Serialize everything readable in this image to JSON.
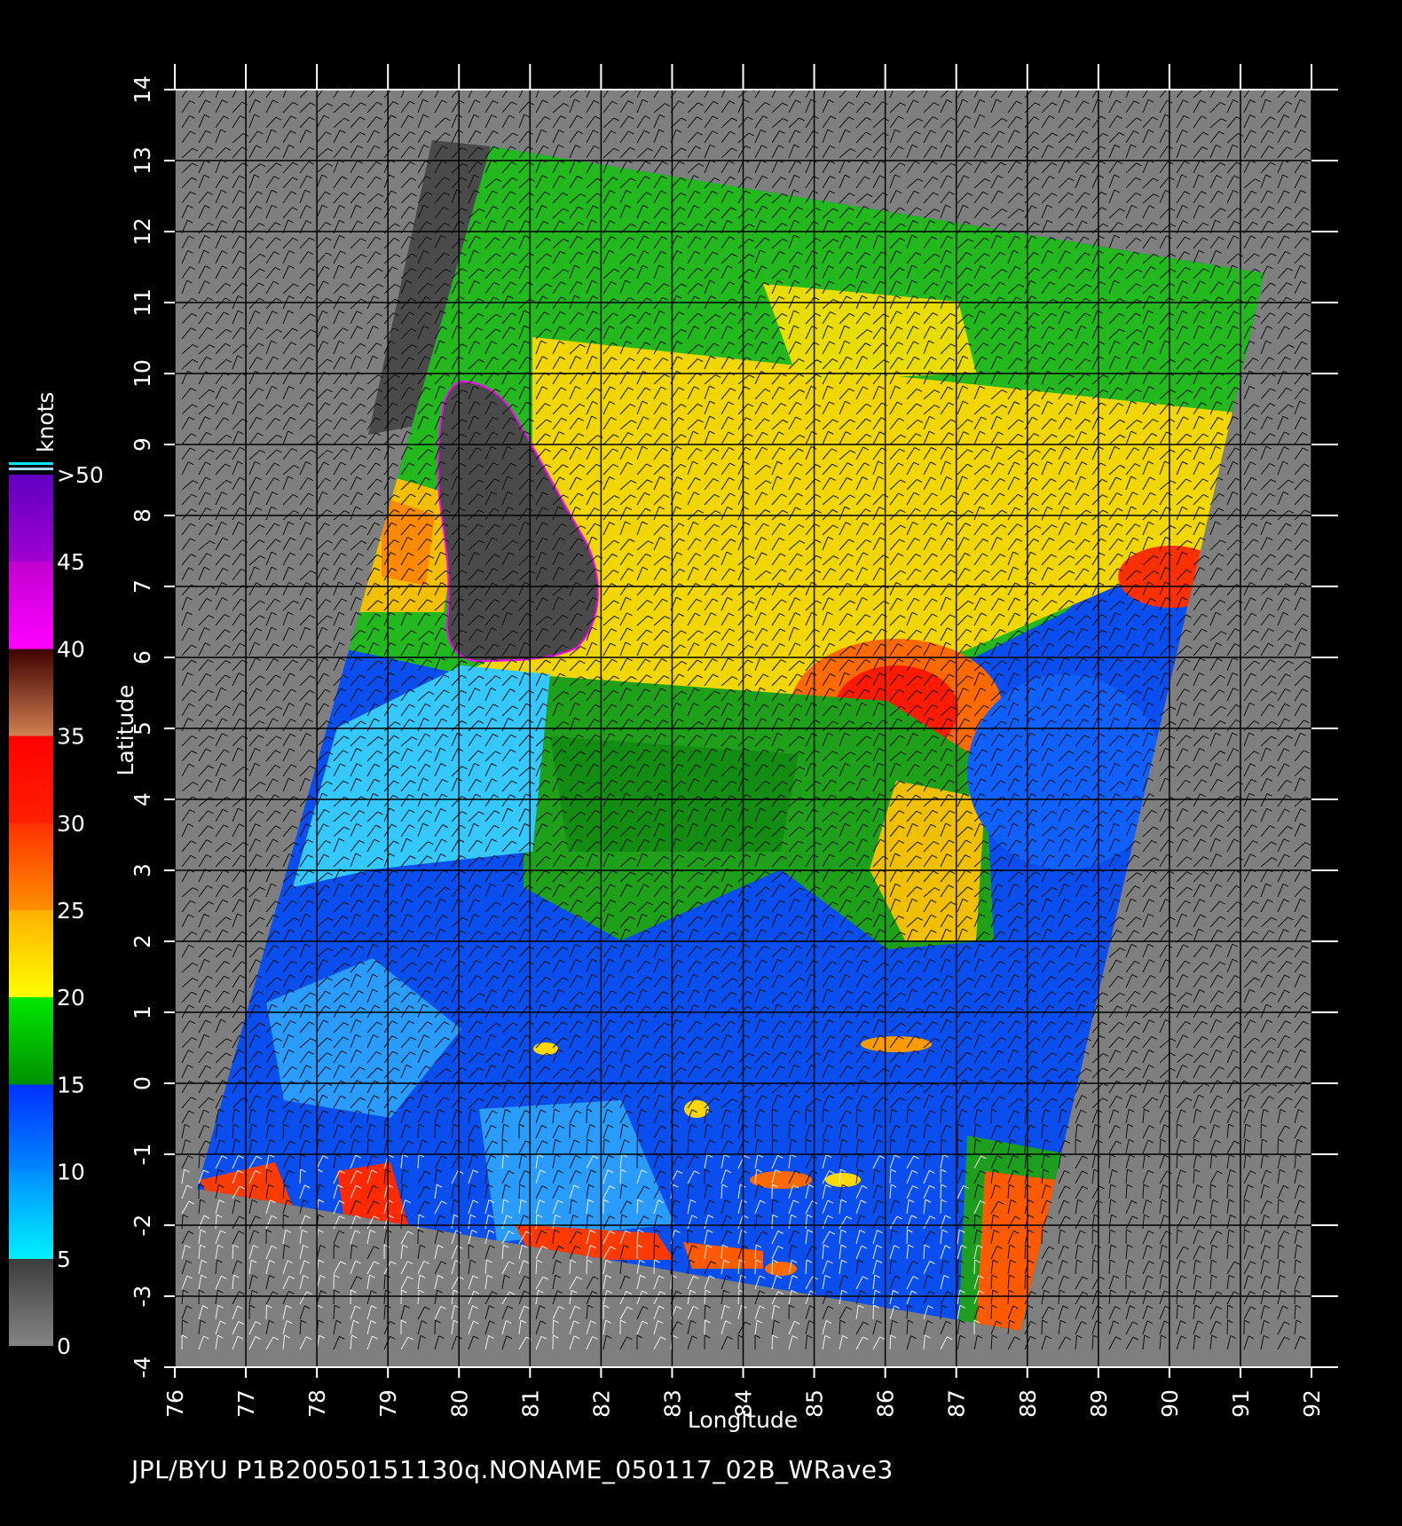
{
  "map": {
    "x_label": "Longitude",
    "y_label": "Latitude",
    "lon_ticks": [
      "76",
      "77",
      "78",
      "79",
      "80",
      "81",
      "82",
      "83",
      "84",
      "85",
      "86",
      "87",
      "88",
      "89",
      "90",
      "91",
      "92"
    ],
    "lat_ticks": [
      "14",
      "13",
      "12",
      "11",
      "10",
      "9",
      "8",
      "7",
      "6",
      "5",
      "4",
      "3",
      "2",
      "1",
      "0",
      "-1",
      "-2",
      "-3",
      "-4"
    ],
    "lon_range": [
      76,
      92
    ],
    "lat_range": [
      -4,
      14
    ]
  },
  "colorbar": {
    "unit": "knots",
    "tick_labels": [
      ">50",
      "45",
      "40",
      "35",
      "30",
      "25",
      "20",
      "15",
      "10",
      "5",
      "0"
    ],
    "bands": [
      {
        "range": "0-5",
        "color": "#707070"
      },
      {
        "range": "5-10",
        "color": "#00e5ff"
      },
      {
        "range": "10-15",
        "color": "#0050ff"
      },
      {
        "range": "15-20",
        "color": "#00b000"
      },
      {
        "range": "20-25",
        "color": "#ffd800"
      },
      {
        "range": "25-30",
        "color": "#ff6a00"
      },
      {
        "range": "30-35",
        "color": "#ff1a00"
      },
      {
        "range": "35-40",
        "color": "#a0522d"
      },
      {
        "range": "40-45",
        "color": "#ff00ff"
      },
      {
        "range": "45-50",
        "color": "#9000d0"
      }
    ]
  },
  "colors": {
    "background": "#000000",
    "no_data": "#7f7f7f",
    "land": "#4a4a4a",
    "grid": "#000000",
    "text": "#ffffff"
  },
  "footer": "JPL/BYU  P1B20050151130q.NONAME_050117_02B_WRave3"
}
